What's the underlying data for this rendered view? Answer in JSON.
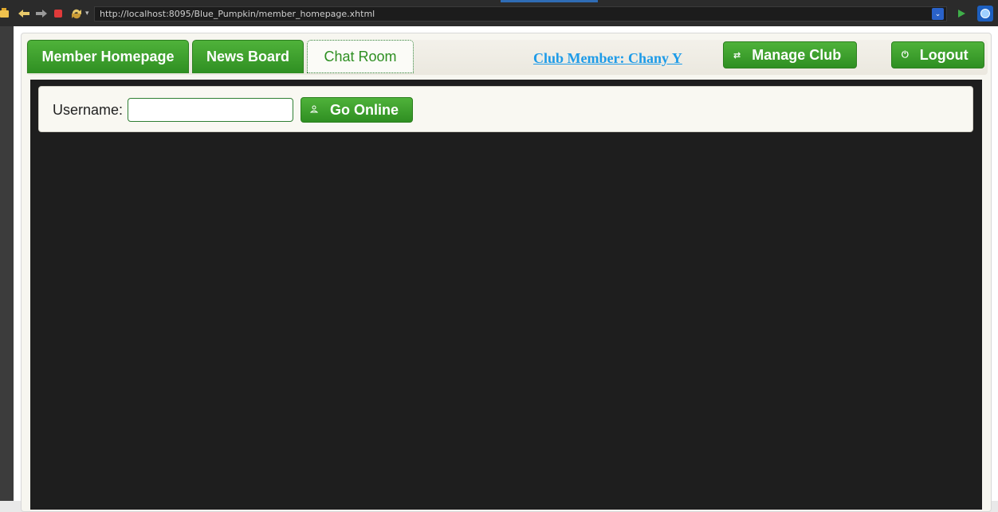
{
  "browser": {
    "url": "http://localhost:8095/Blue_Pumpkin/member_homepage.xhtml",
    "icons": [
      "folder-icon",
      "back-icon",
      "forward-icon",
      "stop-icon",
      "refresh-icon",
      "go-icon",
      "extension-icon"
    ],
    "dropdown_glyph": "▾",
    "url_dropdown_glyph": "⌄"
  },
  "tabs": [
    {
      "label": "Member Homepage",
      "active": false
    },
    {
      "label": "News Board",
      "active": false
    },
    {
      "label": "Chat Room",
      "active": true
    }
  ],
  "header": {
    "member_link": "Club Member: Chany Y",
    "manage_button": {
      "label": "Manage Club",
      "icon": "⇄"
    },
    "logout_button": {
      "label": "Logout",
      "icon": "⏻"
    }
  },
  "chat_form": {
    "username_label": "Username:",
    "username_value": "",
    "username_placeholder": "",
    "go_online_button": {
      "label": "Go Online",
      "icon": "👤"
    }
  },
  "colors": {
    "accent_green": "#3a9a2a",
    "link_blue": "#1d9be8",
    "chat_background": "#1e1e1e"
  }
}
